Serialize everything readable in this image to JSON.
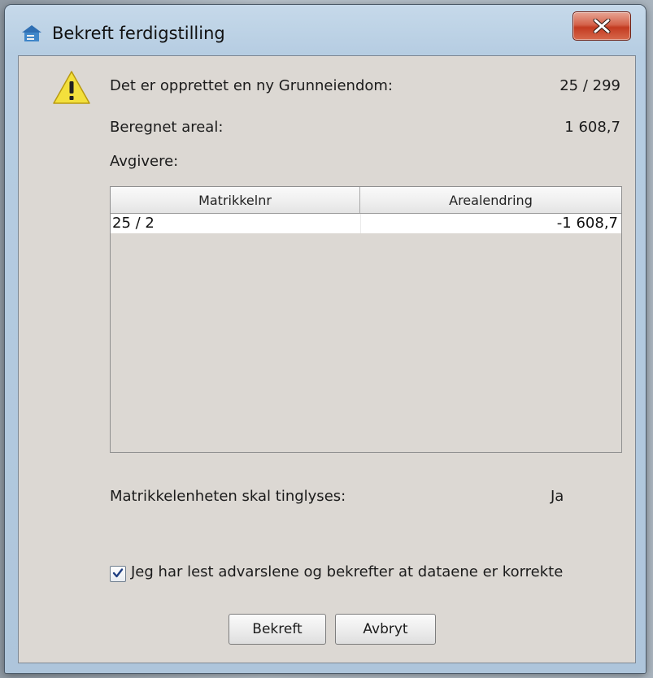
{
  "window": {
    "title": "Bekreft ferdigstilling"
  },
  "info": {
    "new_property_label": "Det er opprettet en ny Grunneiendom:",
    "new_property_value": "25 / 299",
    "area_label": "Beregnet areal:",
    "area_value": "1 608,7",
    "givers_label": "Avgivere:"
  },
  "table": {
    "columns": [
      "Matrikkelnr",
      "Arealendring"
    ],
    "rows": [
      {
        "matrikkelnr": "25 / 2",
        "arealendring": "-1 608,7"
      }
    ]
  },
  "registration": {
    "label": "Matrikkelenheten skal tinglyses:",
    "value": "Ja"
  },
  "confirm_checkbox": {
    "label": "Jeg har lest advarslene og bekrefter at dataene er korrekte",
    "checked": true
  },
  "buttons": {
    "confirm": "Bekreft",
    "cancel": "Avbryt"
  },
  "icons": {
    "title": "house-icon",
    "warning": "warning-icon",
    "close": "close-icon",
    "check": "checkmark-icon"
  }
}
